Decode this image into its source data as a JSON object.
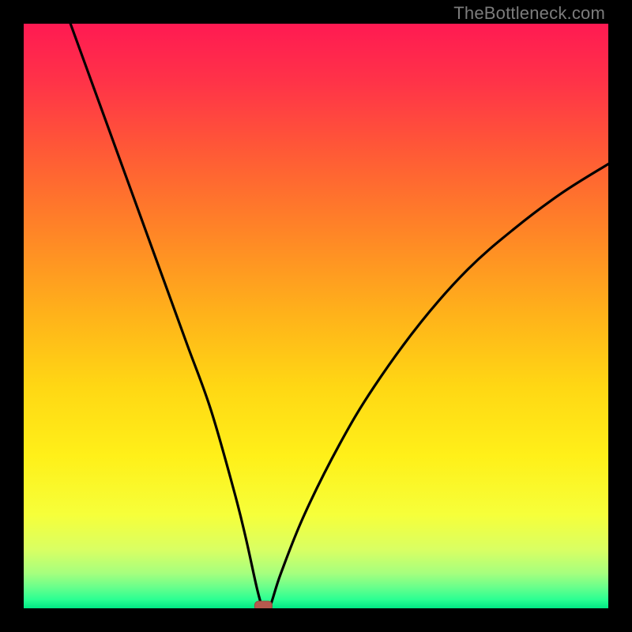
{
  "watermark": "TheBottleneck.com",
  "colors": {
    "frame": "#000000",
    "curve": "#000000",
    "marker_fill": "#b6594e",
    "marker_stroke": "#9a4a41",
    "gradient_stops": [
      {
        "offset": 0.0,
        "color": "#ff1a52"
      },
      {
        "offset": 0.1,
        "color": "#ff3348"
      },
      {
        "offset": 0.22,
        "color": "#ff5a36"
      },
      {
        "offset": 0.35,
        "color": "#ff8327"
      },
      {
        "offset": 0.5,
        "color": "#ffb31a"
      },
      {
        "offset": 0.62,
        "color": "#ffd714"
      },
      {
        "offset": 0.74,
        "color": "#fff019"
      },
      {
        "offset": 0.84,
        "color": "#f6ff3a"
      },
      {
        "offset": 0.9,
        "color": "#d9ff63"
      },
      {
        "offset": 0.94,
        "color": "#a6ff7e"
      },
      {
        "offset": 0.965,
        "color": "#66ff8c"
      },
      {
        "offset": 0.985,
        "color": "#2bff92"
      },
      {
        "offset": 1.0,
        "color": "#00e884"
      }
    ]
  },
  "chart_data": {
    "type": "line",
    "title": "",
    "xlabel": "",
    "ylabel": "",
    "xlim": [
      0,
      100
    ],
    "ylim": [
      0,
      100
    ],
    "series": [
      {
        "name": "bottleneck_curve",
        "description": "V-shaped bottleneck curve; vertical axis reads as bottleneck percentage (0 at bottom / green, 100 at top / red). Minimum sits near x≈41 where the value touches 0.",
        "x": [
          8,
          12,
          16,
          20,
          24,
          28,
          32,
          36,
          38,
          40,
          41,
          42,
          44,
          48,
          54,
          60,
          68,
          76,
          84,
          92,
          100
        ],
        "values": [
          100,
          89,
          78,
          67,
          56,
          45,
          34,
          20,
          12,
          3,
          0,
          0,
          6,
          16,
          28,
          38,
          49,
          58,
          65,
          71,
          76
        ]
      }
    ],
    "marker": {
      "x": 41,
      "y": 0,
      "shape": "rounded-rect"
    }
  }
}
